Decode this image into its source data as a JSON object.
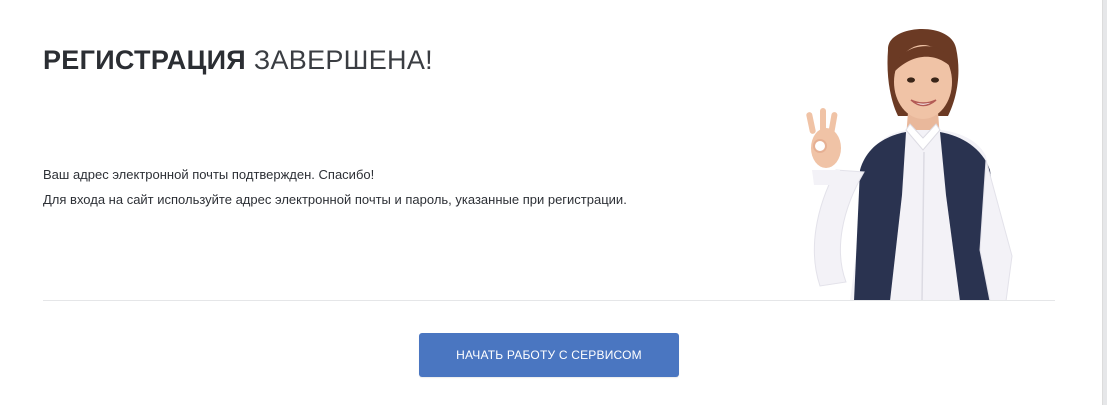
{
  "heading": {
    "bold_part": "РЕГИСТРАЦИЯ",
    "light_part": "ЗАВЕРШЕНА!"
  },
  "message": {
    "line1": "Ваш адрес электронной почты подтвержден. Спасибо!",
    "line2": "Для входа на сайт используйте адрес электронной почты и пароль, указанные при регистрации."
  },
  "actions": {
    "start_button_label": "НАЧАТЬ РАБОТУ С СЕРВИСОМ"
  },
  "colors": {
    "accent": "#4a76c1",
    "text": "#2b2e33",
    "vest": "#2a3350",
    "shirt": "#f3f2f7",
    "hair": "#6b3a24"
  },
  "illustration": {
    "icon": "woman-ok-gesture-illustration"
  }
}
